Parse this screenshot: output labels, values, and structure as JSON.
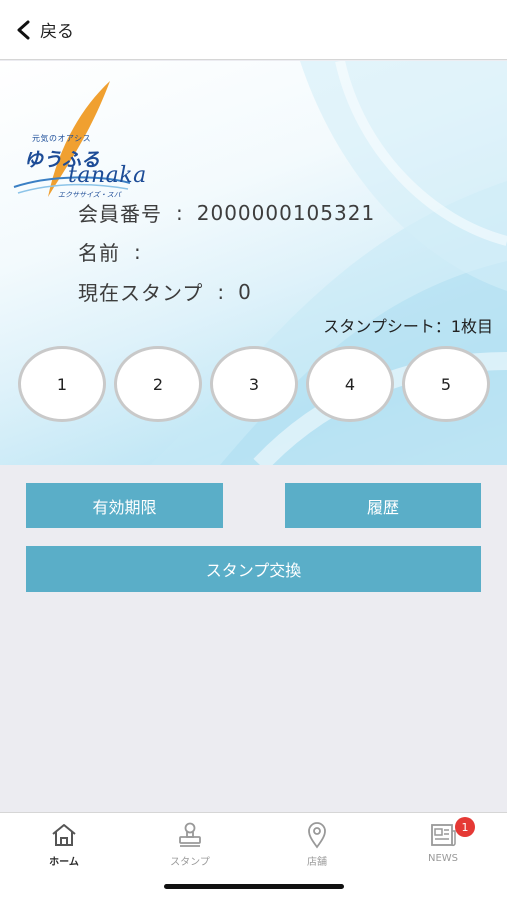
{
  "header": {
    "back_label": "戻る"
  },
  "logo": {
    "tagline": "元気のオアシス",
    "name_part1": "ゆうふる",
    "name_part2": "tanaka",
    "subtitle": "エクササイズ・スパ"
  },
  "member": {
    "number_label": "会員番号",
    "number_value": "2000000105321",
    "name_label": "名前",
    "name_value": "",
    "stamp_label": "現在スタンプ",
    "stamp_value": "0",
    "colon": ":"
  },
  "stamp_sheet": {
    "label": "スタンプシート：1枚目",
    "slots": [
      "1",
      "2",
      "3",
      "4",
      "5"
    ]
  },
  "buttons": {
    "expiry": "有効期限",
    "history": "履歴",
    "exchange": "スタンプ交換"
  },
  "tabbar": {
    "items": [
      {
        "label": "ホーム",
        "icon": "home-icon",
        "active": true
      },
      {
        "label": "スタンプ",
        "icon": "stamp-icon",
        "active": false
      },
      {
        "label": "店舗",
        "icon": "location-pin-icon",
        "active": false
      },
      {
        "label": "NEWS",
        "icon": "newspaper-icon",
        "active": false,
        "badge": "1"
      }
    ]
  },
  "colors": {
    "button": "#5aaec8",
    "badge": "#e53935",
    "logo_blue": "#1d4c97",
    "logo_orange": "#f0a030"
  }
}
